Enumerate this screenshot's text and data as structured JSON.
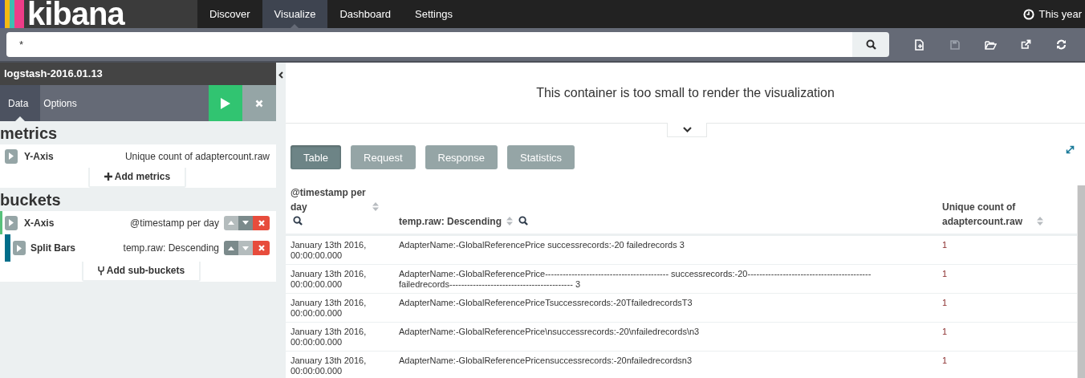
{
  "logo": "kibana",
  "nav": [
    {
      "label": "Discover",
      "selected": false
    },
    {
      "label": "Visualize",
      "selected": true
    },
    {
      "label": "Dashboard",
      "selected": false
    },
    {
      "label": "Settings",
      "selected": false
    }
  ],
  "time_picker": "This year",
  "search": {
    "value": "*"
  },
  "toolbar": [
    {
      "kind": "new",
      "disabled": false
    },
    {
      "kind": "save",
      "disabled": true
    },
    {
      "kind": "open",
      "disabled": false
    },
    {
      "kind": "share",
      "disabled": false
    },
    {
      "kind": "refresh",
      "disabled": false
    }
  ],
  "index_pattern": "logstash-2016.01.13",
  "sidebar_tabs": [
    {
      "label": "Data",
      "selected": true
    },
    {
      "label": "Options",
      "selected": false
    }
  ],
  "sections": [
    {
      "title": "metrics",
      "add_label": "Add metrics",
      "aggs": [
        {
          "label": "Y-Axis",
          "description": "Unique count of adaptercount.raw"
        }
      ]
    },
    {
      "title": "buckets",
      "add_label": "Add sub-buckets",
      "aggs": [
        {
          "label": "X-Axis",
          "description": "@timestamp per day",
          "color": "#57c17b",
          "up_disabled": true,
          "down_disabled": false,
          "children": [
            {
              "label": "Split Bars",
              "description": "temp.raw: Descending",
              "color": "#006e8a",
              "up_disabled": false,
              "down_disabled": true
            }
          ]
        }
      ]
    }
  ],
  "message": "This container is too small to render the visualization",
  "inspector_tabs": [
    {
      "label": "Table",
      "selected": true
    },
    {
      "label": "Request",
      "selected": false
    },
    {
      "label": "Response",
      "selected": false
    },
    {
      "label": "Statistics",
      "selected": false
    }
  ],
  "table": {
    "columns": [
      "@timestamp per day",
      "temp.raw: Descending",
      "Unique count of adaptercount.raw"
    ],
    "rows": [
      [
        "January 13th 2016, 00:00:00.000",
        "AdapterName:-GlobalReferencePrice successrecords:-20 failedrecords 3",
        "1"
      ],
      [
        "January 13th 2016, 00:00:00.000",
        "AdapterName:-GlobalReferencePrice------------------------------------------ successrecords:-20------------------------------------------ failedrecords------------------------------------------ 3",
        "1"
      ],
      [
        "January 13th 2016, 00:00:00.000",
        "AdapterName:-GlobalReferencePriceTsuccessrecords:-20TfailedrecordsT3",
        "1"
      ],
      [
        "January 13th 2016, 00:00:00.000",
        "AdapterName:-GlobalReferencePrice\\nsuccessrecords:-20\\nfailedrecords\\n3",
        "1"
      ],
      [
        "January 13th 2016, 00:00:00.000",
        "AdapterName:-GlobalReferencePricensuccessrecords:-20nfailedrecordsn3",
        "1"
      ]
    ]
  }
}
